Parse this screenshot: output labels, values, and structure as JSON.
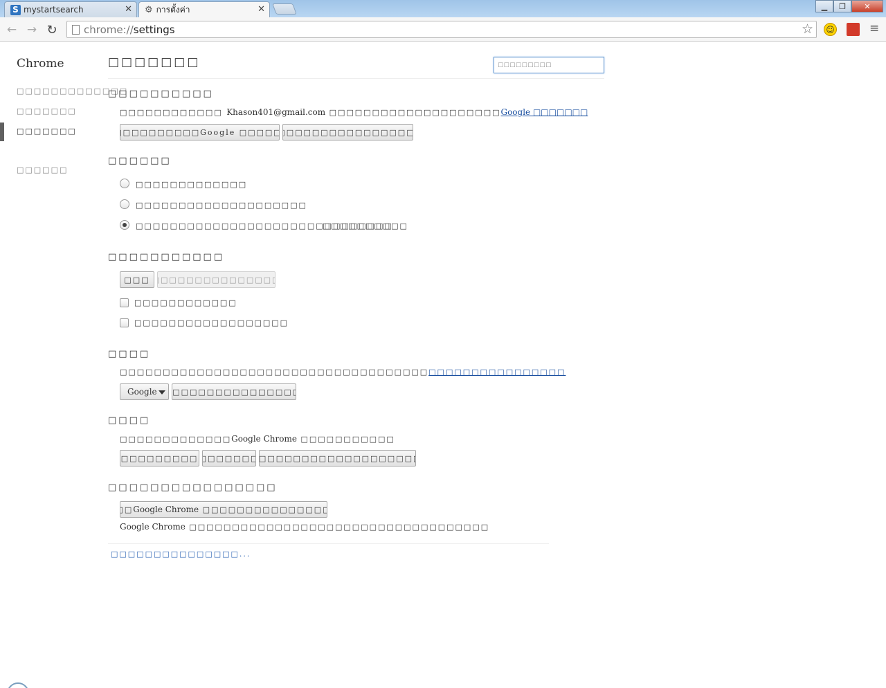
{
  "tabs": [
    {
      "label": "mystartsearch",
      "favicon_letter": "S",
      "active": false
    },
    {
      "label": "การตั้งค่า",
      "active": true
    }
  ],
  "toolbar": {
    "url_scheme": "chrome://",
    "url_path": "settings"
  },
  "sidebar": {
    "brand": "Chrome",
    "items": [
      {
        "label": "□□□□□□□□□□□□□",
        "selected": false
      },
      {
        "label": "□□□□□□□",
        "selected": false
      },
      {
        "label": "□□□□□□□",
        "selected": true
      },
      {
        "label": "□□□□□□",
        "selected": false
      }
    ]
  },
  "page": {
    "title": "□□□□□□□",
    "search_placeholder": "□□□□□□□□□"
  },
  "signin": {
    "title": "□□□□□□□□□□",
    "text_prefix": "□□□□□□□□□□□□",
    "email": "Khason401@gmail.com",
    "text_mid": "□□□□□□□□□□□□□□□□□□□□",
    "link": "Google □□□□□□□",
    "disconnect_button": "□□□□□□□□□□□□Google □□□□□□...",
    "advanced_sync_button": "□□□□□□□□□□□□□□□□□□□□□..."
  },
  "startup": {
    "title": "□□□□□□",
    "options": [
      {
        "label": "□□□□□□□□□□□□□",
        "checked": false
      },
      {
        "label": "□□□□□□□□□□□□□□□□□□□□",
        "checked": false
      },
      {
        "label": "□□□□□□□□□□□□□□□□□□□□□□□□□□□□□□",
        "checked": true
      }
    ],
    "set_pages_link": "□□□□□□□□□□"
  },
  "appearance": {
    "title": "□□□□□□□□□□□",
    "theme_button": "□□□",
    "reset_theme_button": "□□□□□□□□□□□□□□□□□",
    "checkboxes": [
      {
        "label": "□□□□□□□□□□□□",
        "checked": false
      },
      {
        "label": "□□□□□□□□□□□□□□□□□□",
        "checked": false
      }
    ]
  },
  "search": {
    "title": "□□□□",
    "text": "□□□□□□□□□□□□□□□□□□□□□□□□□□□□□□□□□□□□",
    "link": "□□□□□□□□□□□□□□□□",
    "engine_selected": "Google",
    "manage_button": "□□□□□□□□□□□□□□□□□□□..."
  },
  "users": {
    "title": "□□□□",
    "text_prefix": "□□□□□",
    "text_mid": "□□□□□□□□",
    "product": "Google Chrome",
    "text_suffix": "□□□□□□□□□□□",
    "add_button": "□□□□□□□□□□□",
    "delete_button": "□□□□□□□",
    "import_button": "□□□□□□□□□□□□□□□□□□□□□□□□□..."
  },
  "default_browser": {
    "title": "□□□□□□□□□□□□□□□□",
    "button_prefix": "□□□□□",
    "button_product": "Google Chrome",
    "button_suffix": "□□□□□□□□□□□□□□□□□□",
    "status_product": "Google Chrome",
    "status_text": "□□□□□□□□□□□□□□□□□□□□□□□□□□□□□□□□□□□"
  },
  "advanced_link": "□□□□□□□□□□□□□□□..."
}
